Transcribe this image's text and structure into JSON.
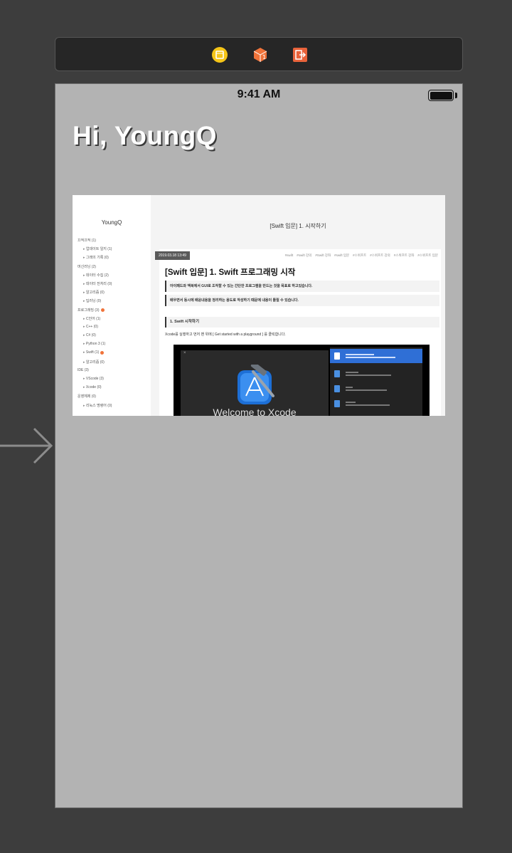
{
  "status_bar": {
    "time": "9:41 AM"
  },
  "screen": {
    "title": "Hi, YoungQ"
  },
  "blog": {
    "brand": "YoungQ",
    "header_title": "[Swift 입문] 1. 시작하기",
    "categories": [
      {
        "label": "끄적끄적 (1)",
        "sub": false,
        "new": false
      },
      {
        "label": "업데이트 일지 (1)",
        "sub": true,
        "new": false
      },
      {
        "label": "그래의 기록 (0)",
        "sub": true,
        "new": false
      },
      {
        "label": "머신러닝 (2)",
        "sub": false,
        "new": false
      },
      {
        "label": "데이터 수집 (2)",
        "sub": true,
        "new": false
      },
      {
        "label": "데이터 전처리 (0)",
        "sub": true,
        "new": false
      },
      {
        "label": "알고리즘 (0)",
        "sub": true,
        "new": false
      },
      {
        "label": "딥러닝 (0)",
        "sub": true,
        "new": false
      },
      {
        "label": "프로그래밍 (3)",
        "sub": false,
        "new": true
      },
      {
        "label": "C언어 (1)",
        "sub": true,
        "new": false
      },
      {
        "label": "C++ (0)",
        "sub": true,
        "new": false
      },
      {
        "label": "C# (0)",
        "sub": true,
        "new": false
      },
      {
        "label": "Python 3 (1)",
        "sub": true,
        "new": false
      },
      {
        "label": "Swift (1)",
        "sub": true,
        "new": true
      },
      {
        "label": "알고리즘 (0)",
        "sub": true,
        "new": false
      },
      {
        "label": "IDE (3)",
        "sub": false,
        "new": false
      },
      {
        "label": "VScode (3)",
        "sub": true,
        "new": false
      },
      {
        "label": "Xcode (0)",
        "sub": true,
        "new": false
      },
      {
        "label": "운영체제 (0)",
        "sub": false,
        "new": false
      },
      {
        "label": "리눅스 명령어 (0)",
        "sub": true,
        "new": false
      }
    ],
    "post": {
      "date": "2019.03.18 13:49",
      "tags": [
        "#swift",
        "#swift 강의",
        "#Swift 강좌",
        "#swift 입문",
        "#스위프트",
        "#스위프트 강의",
        "#스위프트 강좌",
        "#스위프트 입문"
      ],
      "title": "[Swift 입문] 1. Swift 프로그래밍 시작",
      "quote1": "아이패드와 맥북에서 GUI로 조작할 수 있는 간단한 프로그램을 만드는 것을 목표로 하고있습니다.",
      "quote2": "배우면서 동시에 배운내용을 정리하는 용도로 작성하기 때문에 내용이 틀릴 수 있습니다.",
      "section": "1. Swift 시작하기",
      "paragraph": "Xcode를 실행하고 먼저 맨 위에 [ Get started with a playground ] 를 클릭합니다.",
      "xcode_welcome": "Welcome to Xcode",
      "xcode_close": "×"
    }
  },
  "colors": {
    "canvas": "#3d3d3d",
    "device": "#b3b3b3",
    "scene_icon_vc": "#f5c518",
    "scene_icon_first_responder": "#f0733a",
    "scene_icon_exit": "#e8623a"
  }
}
